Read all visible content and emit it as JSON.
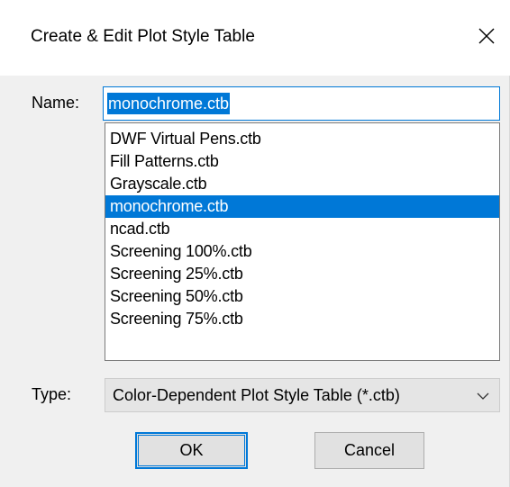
{
  "dialog": {
    "title": "Create & Edit Plot Style Table",
    "close_icon": "close-icon"
  },
  "name": {
    "label": "Name:",
    "value": "monochrome.ctb"
  },
  "list": {
    "items": [
      "DWF Virtual Pens.ctb",
      "Fill Patterns.ctb",
      "Grayscale.ctb",
      "monochrome.ctb",
      "ncad.ctb",
      "Screening 100%.ctb",
      "Screening 25%.ctb",
      "Screening 50%.ctb",
      "Screening 75%.ctb"
    ],
    "selected": "monochrome.ctb"
  },
  "type": {
    "label": "Type:",
    "value": "Color-Dependent Plot Style Table (*.ctb)",
    "chevron_icon": "chevron-down-icon"
  },
  "buttons": {
    "ok_label": "OK",
    "cancel_label": "Cancel"
  },
  "colors": {
    "accent": "#0078d7",
    "dialog_bg": "#f0f0f0",
    "titlebar_bg": "#ffffff"
  }
}
